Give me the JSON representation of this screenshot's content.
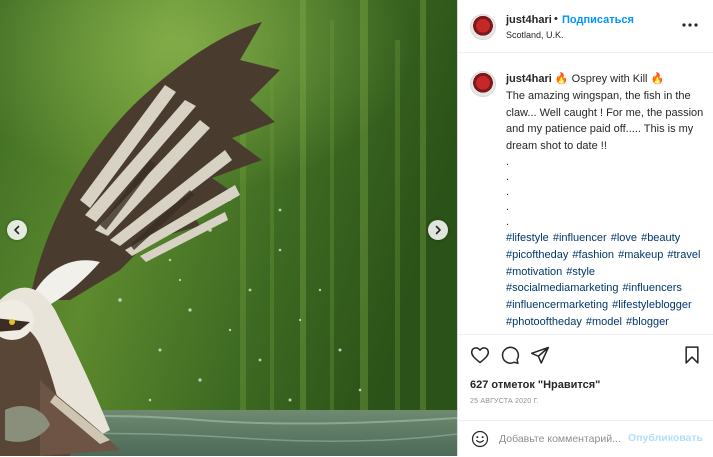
{
  "post": {
    "username": "just4hari",
    "separator": "•",
    "follow_label": "Подписаться",
    "location": "Scotland, U.K."
  },
  "caption": {
    "username": "just4hari",
    "title": " 🔥 Osprey with Kill 🔥",
    "text": "The amazing wingspan, the fish in the claw... Well caught ! For me, the passion and my patience paid off..... This is my dream shot to date !!",
    "dots": [
      ".",
      ".",
      ".",
      ".",
      "."
    ],
    "hashtags": "#lifestyle #influencer #love #beauty #picoftheday #fashion #makeup #travel #motivation #style #socialmediamarketing #influencers #influencermarketing #lifestyleblogger #photooftheday #model #blogger #influencerstyle #digitalmarketing #styleblogger #streetstyle #socialmedia #fashionista #bloggerstyle"
  },
  "stats": {
    "likes_text": "627 отметок \"Нравится\"",
    "date": "25 АВГУСТА 2020 Г."
  },
  "comment_box": {
    "placeholder": "Добавьте комментарий...",
    "publish_label": "Опубликовать"
  },
  "icons": {
    "prev": "chevron-left-icon",
    "next": "chevron-right-icon",
    "more": "more-options-icon",
    "like": "heart-icon",
    "comment": "comment-bubble-icon",
    "share": "paper-plane-icon",
    "save": "bookmark-icon",
    "emoji": "smiley-icon"
  },
  "colors": {
    "accent": "#0095f6",
    "hashtag": "#00376b",
    "publish_disabled": "#b2dffc",
    "muted": "#8e8e8e"
  }
}
